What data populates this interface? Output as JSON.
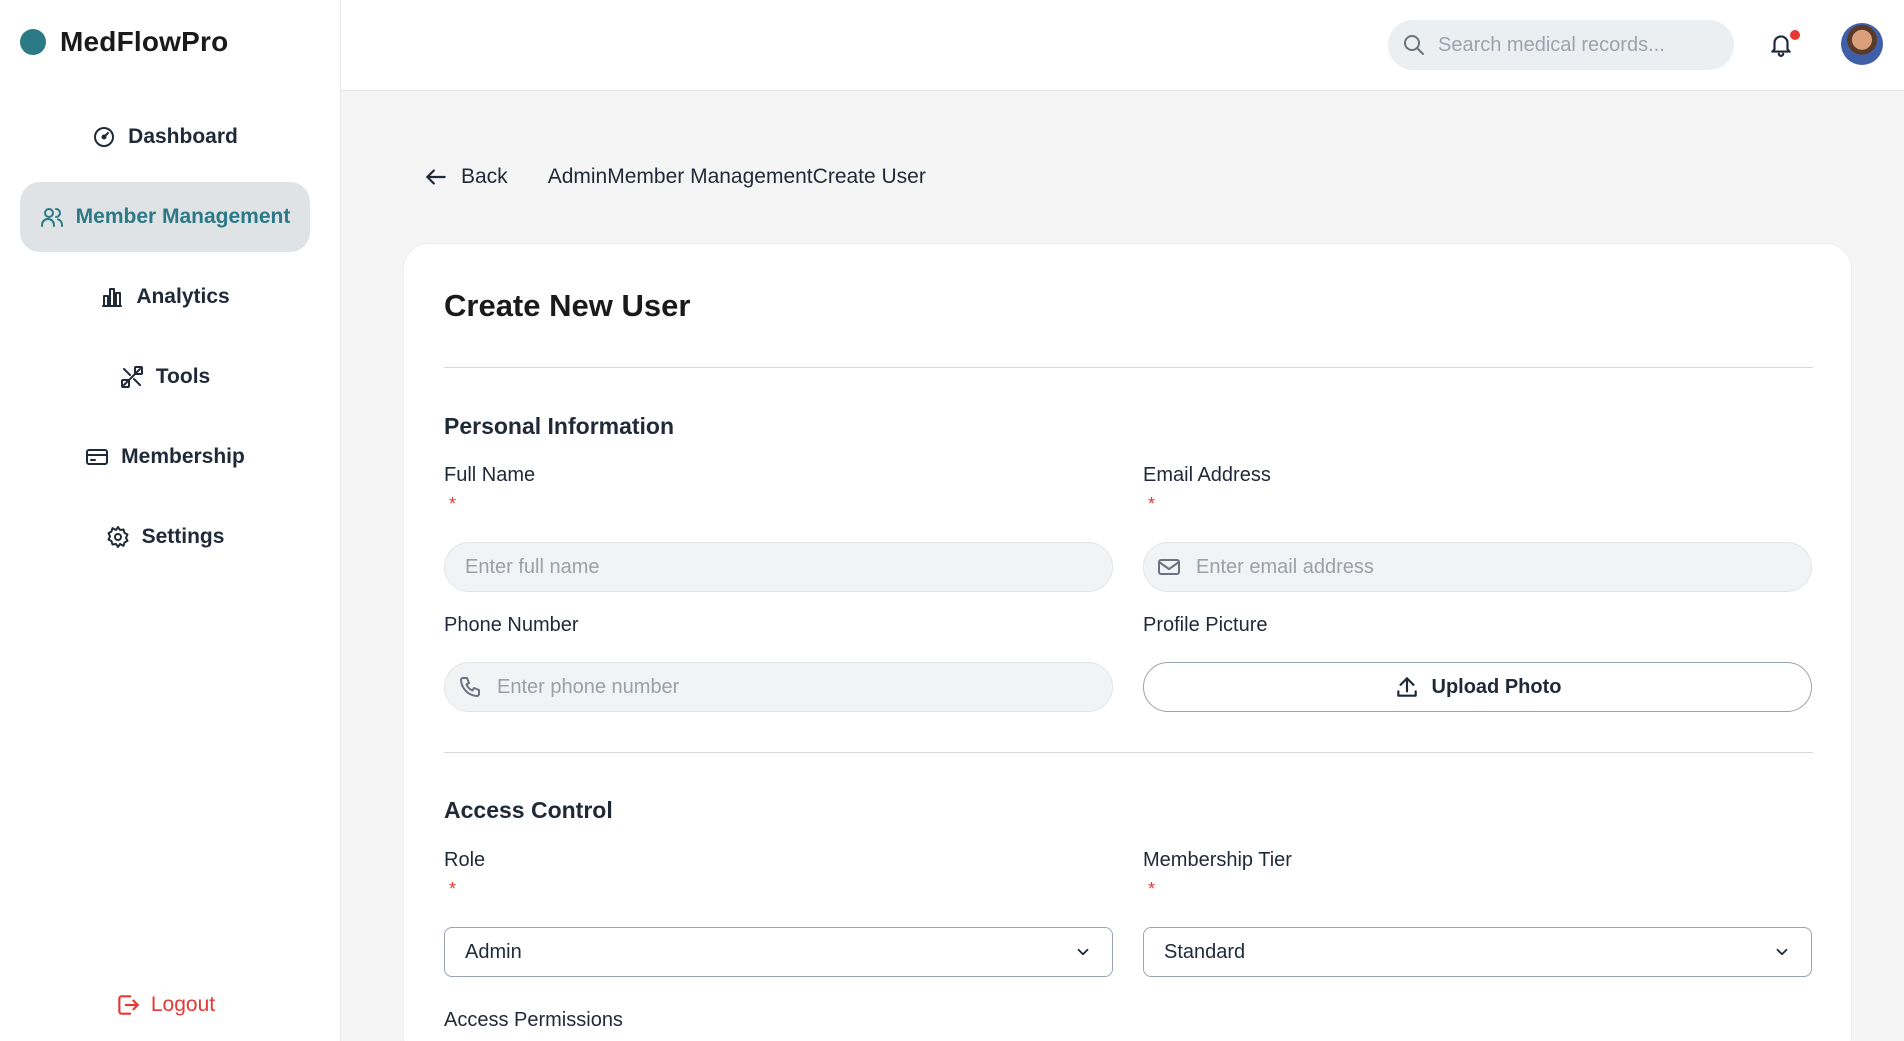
{
  "brand": {
    "name": "MedFlowPro",
    "accent": "#2b7a86"
  },
  "sidebar": {
    "items": [
      {
        "label": "Dashboard",
        "icon": "gauge-icon"
      },
      {
        "label": "Member Management",
        "icon": "users-icon",
        "active": true
      },
      {
        "label": "Analytics",
        "icon": "bar-chart-icon"
      },
      {
        "label": "Tools",
        "icon": "tools-icon"
      },
      {
        "label": "Membership",
        "icon": "card-icon"
      },
      {
        "label": "Settings",
        "icon": "gear-icon"
      }
    ],
    "logout_label": "Logout"
  },
  "header": {
    "search_placeholder": "Search medical records...",
    "notification_dot": true
  },
  "breadcrumb": {
    "back_label": "Back",
    "items": [
      "Admin",
      "Member Management",
      "Create User"
    ]
  },
  "form": {
    "title": "Create New User",
    "personal_section": "Personal Information",
    "full_name": {
      "label": "Full Name",
      "required_mark": "*",
      "placeholder": "Enter full name"
    },
    "email": {
      "label": "Email Address",
      "required_mark": "*",
      "placeholder": "Enter email address"
    },
    "phone": {
      "label": "Phone Number",
      "placeholder": "Enter phone number"
    },
    "profile_picture": {
      "label": "Profile Picture",
      "button_label": "Upload Photo"
    },
    "access_section": "Access Control",
    "role": {
      "label": "Role",
      "required_mark": "*",
      "value": "Admin"
    },
    "membership_tier": {
      "label": "Membership Tier",
      "required_mark": "*",
      "value": "Standard"
    },
    "permissions_label": "Access Permissions"
  }
}
